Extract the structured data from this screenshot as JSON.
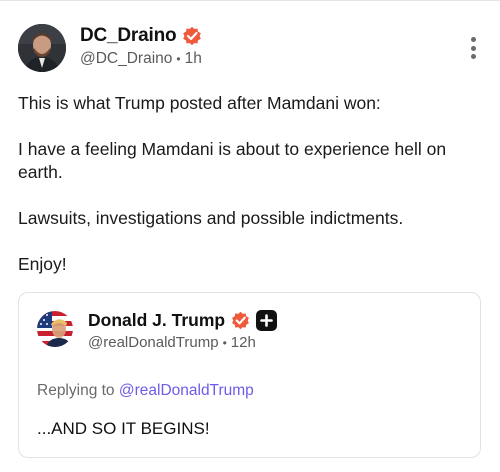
{
  "post": {
    "author": {
      "display_name": "DC_Draino",
      "handle": "@DC_Draino",
      "time": "1h",
      "verified": true,
      "avatar_icon": "profile-photo"
    },
    "more_icon": "vertical-ellipsis-icon",
    "body": [
      "This is what Trump posted after Mamdani won:",
      "I have a feeling Mamdani is about to experience hell on earth.",
      "Lawsuits, investigations and possible indictments.",
      "Enjoy!"
    ]
  },
  "quote": {
    "author": {
      "display_name": "Donald J. Trump",
      "handle": "@realDonaldTrump",
      "time": "12h",
      "verified": true,
      "badge_icon": "plus-badge-icon"
    },
    "replying_prefix": "Replying to",
    "replying_to": "@realDonaldTrump",
    "text": "...AND SO IT BEGINS!"
  },
  "colors": {
    "verified_badge": "#ef5a3c",
    "link": "#6c5ce7",
    "meta_text": "#5b5b5b"
  }
}
